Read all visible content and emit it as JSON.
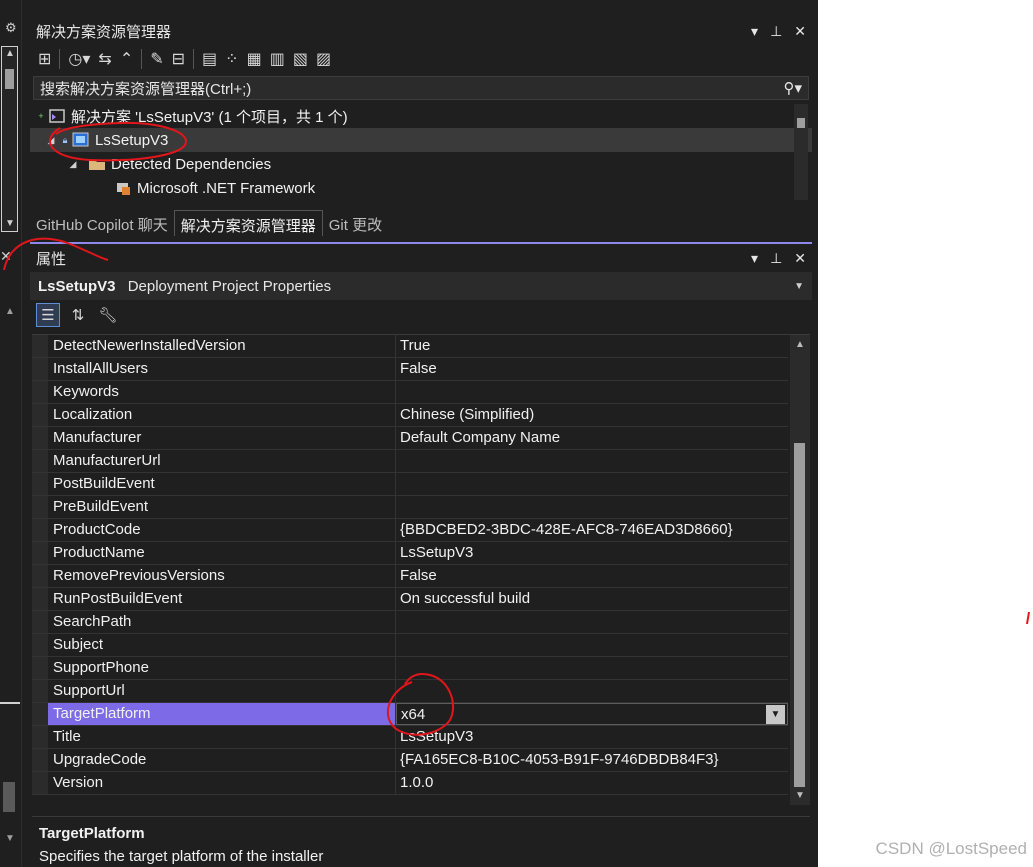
{
  "solution_explorer": {
    "title": "解决方案资源管理器",
    "search_placeholder": "搜索解决方案资源管理器(Ctrl+;)",
    "tree": [
      {
        "label": "解决方案 'LsSetupV3' (1 个项目，共 1 个)",
        "icon": "solution-icon"
      },
      {
        "label": "LsSetupV3",
        "icon": "setup-project-icon"
      },
      {
        "label": "Detected Dependencies",
        "icon": "folder-icon"
      },
      {
        "label": "Microsoft .NET Framework",
        "icon": "dependency-icon"
      }
    ],
    "tabs": [
      "GitHub Copilot 聊天",
      "解决方案资源管理器",
      "Git 更改"
    ]
  },
  "properties": {
    "title": "属性",
    "project_name": "LsSetupV3",
    "project_type": "Deployment Project Properties",
    "rows": [
      {
        "name": "DetectNewerInstalledVersion",
        "value": "True"
      },
      {
        "name": "InstallAllUsers",
        "value": "False"
      },
      {
        "name": "Keywords",
        "value": ""
      },
      {
        "name": "Localization",
        "value": "Chinese (Simplified)"
      },
      {
        "name": "Manufacturer",
        "value": "Default Company Name"
      },
      {
        "name": "ManufacturerUrl",
        "value": ""
      },
      {
        "name": "PostBuildEvent",
        "value": ""
      },
      {
        "name": "PreBuildEvent",
        "value": ""
      },
      {
        "name": "ProductCode",
        "value": "{BBDCBED2-3BDC-428E-AFC8-746EAD3D8660}"
      },
      {
        "name": "ProductName",
        "value": "LsSetupV3"
      },
      {
        "name": "RemovePreviousVersions",
        "value": "False"
      },
      {
        "name": "RunPostBuildEvent",
        "value": "On successful build"
      },
      {
        "name": "SearchPath",
        "value": ""
      },
      {
        "name": "Subject",
        "value": ""
      },
      {
        "name": "SupportPhone",
        "value": ""
      },
      {
        "name": "SupportUrl",
        "value": ""
      },
      {
        "name": "TargetPlatform",
        "value": "x64",
        "selected": true
      },
      {
        "name": "Title",
        "value": "LsSetupV3"
      },
      {
        "name": "UpgradeCode",
        "value": "{FA165EC8-B10C-4053-B91F-9746DBDB84F3}"
      },
      {
        "name": "Version",
        "value": "1.0.0"
      }
    ],
    "description_title": "TargetPlatform",
    "description_text": "Specifies the target platform of the installer"
  },
  "watermark": "CSDN @LostSpeed",
  "colors": {
    "accent": "#7c6ae6",
    "annotation": "#e0161b",
    "background": "#1f1f1f"
  }
}
